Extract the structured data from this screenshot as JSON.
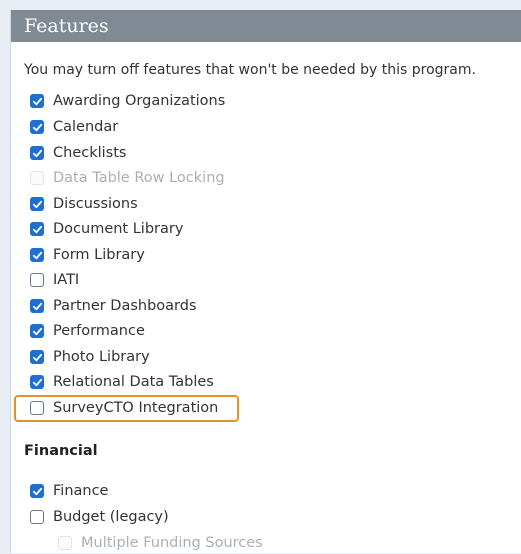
{
  "panel": {
    "title": "Features",
    "intro": "You may turn off features that won't be needed by this program."
  },
  "features": [
    {
      "label": "Awarding Organizations",
      "state": "checked"
    },
    {
      "label": "Calendar",
      "state": "checked"
    },
    {
      "label": "Checklists",
      "state": "checked"
    },
    {
      "label": "Data Table Row Locking",
      "state": "disabled"
    },
    {
      "label": "Discussions",
      "state": "checked"
    },
    {
      "label": "Document Library",
      "state": "checked"
    },
    {
      "label": "Form Library",
      "state": "checked"
    },
    {
      "label": "IATI",
      "state": "unchecked"
    },
    {
      "label": "Partner Dashboards",
      "state": "checked"
    },
    {
      "label": "Performance",
      "state": "checked"
    },
    {
      "label": "Photo Library",
      "state": "checked"
    },
    {
      "label": "Relational Data Tables",
      "state": "checked"
    },
    {
      "label": "SurveyCTO Integration",
      "state": "unchecked"
    }
  ],
  "financial": {
    "title": "Financial",
    "items": [
      {
        "label": "Finance",
        "state": "checked"
      },
      {
        "label": "Budget (legacy)",
        "state": "unchecked"
      },
      {
        "label": "Multiple Funding Sources",
        "state": "disabled"
      }
    ]
  },
  "colors": {
    "header": "#7f8a95",
    "checkbox_checked": "#1f6fd1",
    "highlight": "#e0922f"
  }
}
